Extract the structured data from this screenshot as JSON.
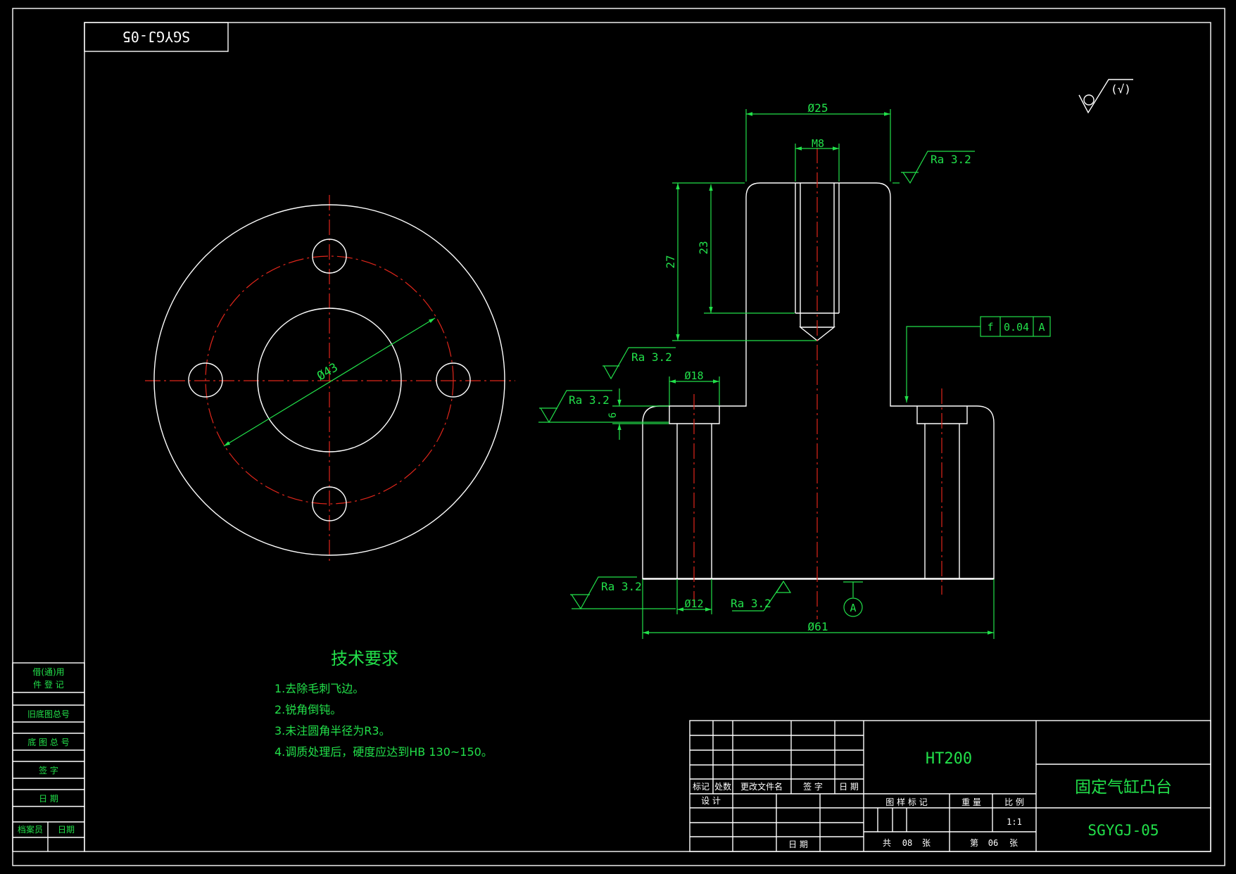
{
  "colors": {
    "background": "#000000",
    "outline": "#ffffff",
    "dimension": "#22e04a",
    "centerline": "#e0261b"
  },
  "corner_code": "SGYGJ-05",
  "top_right_symbol": "(√)",
  "dimensions": {
    "d25": "Ø25",
    "m8": "M8",
    "h27": "27",
    "h23": "23",
    "d43": "Ø43",
    "d18": "Ø18",
    "h6": "6",
    "d12": "Ø12",
    "d61": "Ø61"
  },
  "roughness": {
    "top": "Ra 3.2",
    "step": "Ra 3.2",
    "left": "Ra 3.2",
    "bottom_left": "Ra 3.2",
    "bottom_mid": "Ra 3.2"
  },
  "tolerance": {
    "symbol": "f",
    "value": "0.04",
    "datum": "A"
  },
  "datum_label": "A",
  "tech_requirements": {
    "title": "技术要求",
    "items": [
      "1.去除毛刺飞边。",
      "2.锐角倒钝。",
      "3.未注圆角半径为R3。",
      "4.调质处理后，硬度应达到HB 130~150。"
    ]
  },
  "left_panel": {
    "row1_line1": "借(通)用",
    "row1_line2": "件 登 记",
    "row2": "旧底图总号",
    "row3": "底 图 总 号",
    "row4": "签   字",
    "row5": "日   期",
    "row6_a": "档案员",
    "row6_b": "日期"
  },
  "title_block": {
    "material": "HT200",
    "part_name": "固定气缸凸台",
    "drawing_no": "SGYGJ-05",
    "rev_headers": [
      "标记",
      "处数",
      "更改文件名",
      "签 字",
      "日 期"
    ],
    "design": "设 计",
    "date": "日 期",
    "pattern_mark": "图 样 标 记",
    "weight": "重 量",
    "scale_label": "比 例",
    "scale": "1:1",
    "total_label_a": "共",
    "total_sheets": "08",
    "total_label_b": "张",
    "sheet_label_a": "第",
    "sheet_no": "06",
    "sheet_label_b": "张"
  }
}
